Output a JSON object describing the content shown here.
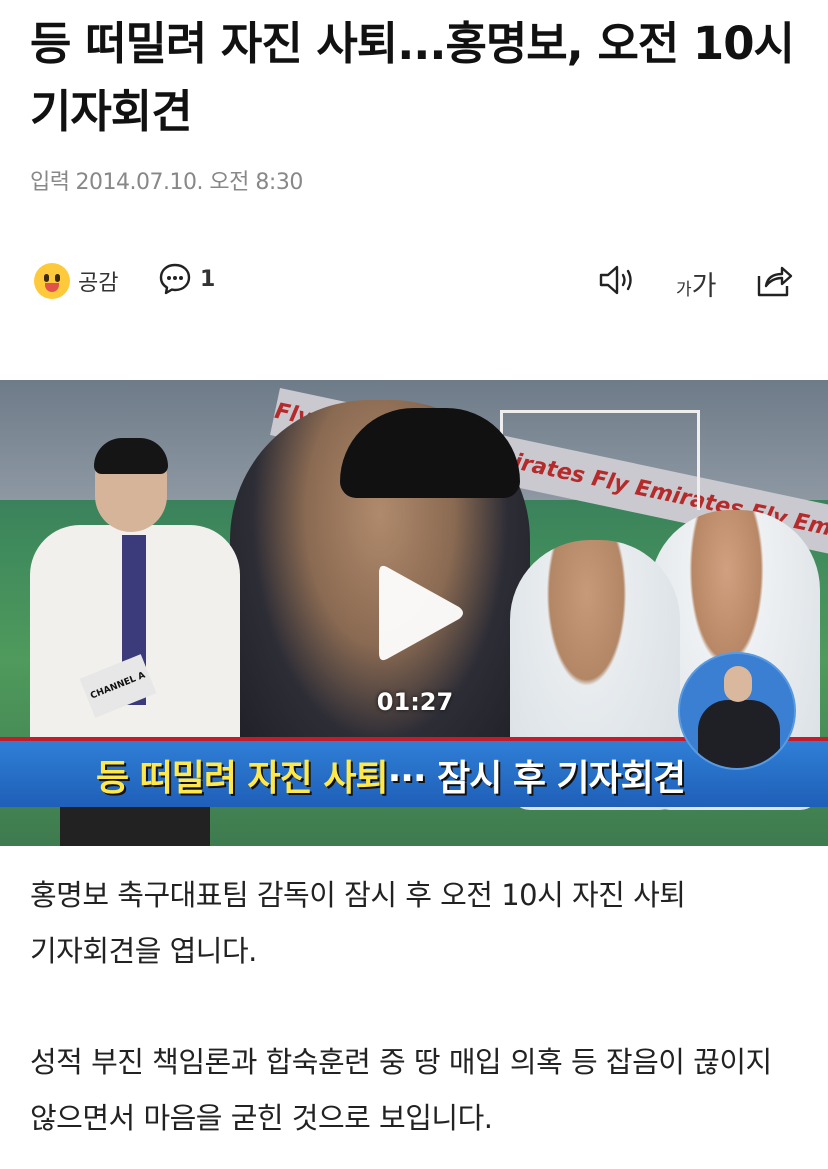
{
  "article": {
    "title": "등 떠밀려 자진 사퇴...홍명보, 오전 10시 기자회견",
    "meta_label": "입력",
    "meta_datetime": "2014.07.10. 오전 8:30"
  },
  "actions": {
    "empathy_label": "공감",
    "comment_count": "1",
    "font_size_label_small": "가",
    "font_size_label_large": "가"
  },
  "video": {
    "duration": "01:27",
    "ticker_part1": "등 떠밀려 자진 사퇴",
    "ticker_part2": "··· 잠시 후 기자회견",
    "board_text": "Fly Emirates   Fly Emirates   Fly Emirates   Fly Emirates",
    "cue_card_text": "CHANNEL A"
  },
  "body": {
    "paragraphs": [
      "홍명보 축구대표팀 감독이 잠시 후 오전 10시 자진 사퇴 기자회견을 엽니다.",
      "성적 부진 책임론과 합숙훈련 중 땅 매입 의혹 등 잡음이 끊이지 않으면서 마음을 굳힌 것으로 보입니다."
    ]
  },
  "colors": {
    "emoji": "#FFC93C",
    "ticker_blue": "#1f5fb8",
    "ticker_yellow": "#ffe94a",
    "meta_gray": "#888888"
  },
  "icons": [
    "smile-emoji-icon",
    "comment-bubble-icon",
    "speaker-icon",
    "share-icon",
    "play-icon"
  ]
}
